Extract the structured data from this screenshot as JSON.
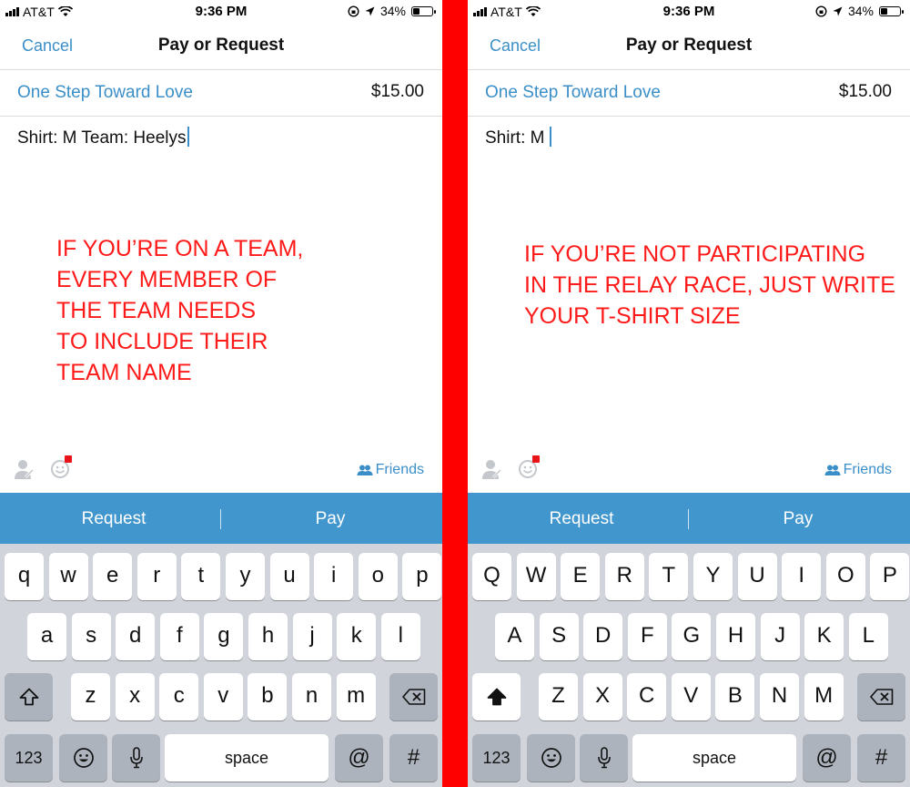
{
  "left": {
    "status": {
      "carrier": "AT&T",
      "time": "9:36 PM",
      "battery": "34%"
    },
    "nav": {
      "cancel": "Cancel",
      "title": "Pay or Request"
    },
    "recipient": "One Step Toward Love",
    "amount": "$15.00",
    "note": "Shirt: M Team: Heelys",
    "annotation_lines": [
      "IF YOU’RE ON A TEAM,",
      "EVERY MEMBER OF",
      "THE TEAM NEEDS",
      "TO INCLUDE THEIR",
      "TEAM NAME"
    ],
    "friends": "Friends",
    "actions": {
      "request": "Request",
      "pay": "Pay"
    },
    "keys": {
      "row1": [
        "q",
        "w",
        "e",
        "r",
        "t",
        "y",
        "u",
        "i",
        "o",
        "p"
      ],
      "row2": [
        "a",
        "s",
        "d",
        "f",
        "g",
        "h",
        "j",
        "k",
        "l"
      ],
      "row3": [
        "z",
        "x",
        "c",
        "v",
        "b",
        "n",
        "m"
      ],
      "numbers": "123",
      "space": "space",
      "at": "@",
      "hash": "#"
    }
  },
  "right": {
    "status": {
      "carrier": "AT&T",
      "time": "9:36 PM",
      "battery": "34%"
    },
    "nav": {
      "cancel": "Cancel",
      "title": "Pay or Request"
    },
    "recipient": "One Step Toward Love",
    "amount": "$15.00",
    "note": "Shirt: M",
    "annotation_lines": [
      "IF YOU’RE NOT PARTICIPATING",
      "IN THE RELAY RACE, JUST WRITE",
      "YOUR T-SHIRT SIZE"
    ],
    "friends": "Friends",
    "actions": {
      "request": "Request",
      "pay": "Pay"
    },
    "keys": {
      "row1": [
        "Q",
        "W",
        "E",
        "R",
        "T",
        "Y",
        "U",
        "I",
        "O",
        "P"
      ],
      "row2": [
        "A",
        "S",
        "D",
        "F",
        "G",
        "H",
        "J",
        "K",
        "L"
      ],
      "row3": [
        "Z",
        "X",
        "C",
        "V",
        "B",
        "N",
        "M"
      ],
      "numbers": "123",
      "space": "space",
      "at": "@",
      "hash": "#"
    }
  },
  "colors": {
    "accent": "#3b8fc8",
    "action_bar": "#4196ce",
    "annotation": "#ff1a1a",
    "divider": "#ff0000"
  },
  "icons": [
    "wifi-icon",
    "location-icon",
    "orientation-lock-icon",
    "battery-icon",
    "person-icon",
    "emoji-icon",
    "friends-icon",
    "shift-icon",
    "backspace-icon",
    "emoji-key-icon",
    "microphone-icon"
  ],
  "battery_level": 0.34
}
